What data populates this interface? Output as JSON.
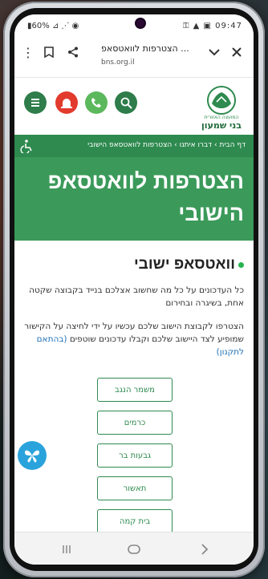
{
  "status_bar": {
    "left": "60%",
    "time": "09:47"
  },
  "browser": {
    "tab_title": "הצטרפות לוואטסאפ ...",
    "url": "bns.org.il",
    "icons": [
      "close-icon",
      "chevron-down-icon",
      "share-icon",
      "bookmark-icon",
      "more-vert-icon"
    ]
  },
  "site": {
    "logo_text_top": "המועצה האזורית",
    "logo_text_main": "בני שמעון",
    "header_icons": [
      "search-icon",
      "phone-icon",
      "alarm-icon",
      "menu-icon"
    ],
    "colors": {
      "brand_green": "#2e8a4f",
      "hero_green": "#3b9a5a",
      "alarm_red": "#e23b2e",
      "phone_green": "#5cb85c",
      "fab_blue": "#2aa3dc"
    }
  },
  "breadcrumb": "דף הבית  ›  דברו איתנו  ›  הצטרפות לוואטסאפ הישובי",
  "hero": {
    "title": "הצטרפות לוואטסאפ הישובי"
  },
  "content": {
    "heading": "וואטסאפ ישובי",
    "para1": "כל העדכונים על כל מה שחשוב אצלכם בנייד בקבוצה שקטה אחת, בשיגרה ובחירום",
    "para2": "הצטרפו לקבוצת הישוב שלכם עכשיו על ידי לחיצה על הקישור שמופיע לצד היישוב שלכם וקבלו עדכונים שוטפים",
    "para2_link": "(בהתאם לתקנון)",
    "villages": [
      "משמר הנגב",
      "כרמים",
      "גבעות בר",
      "תאשור",
      "בית קמה"
    ]
  }
}
